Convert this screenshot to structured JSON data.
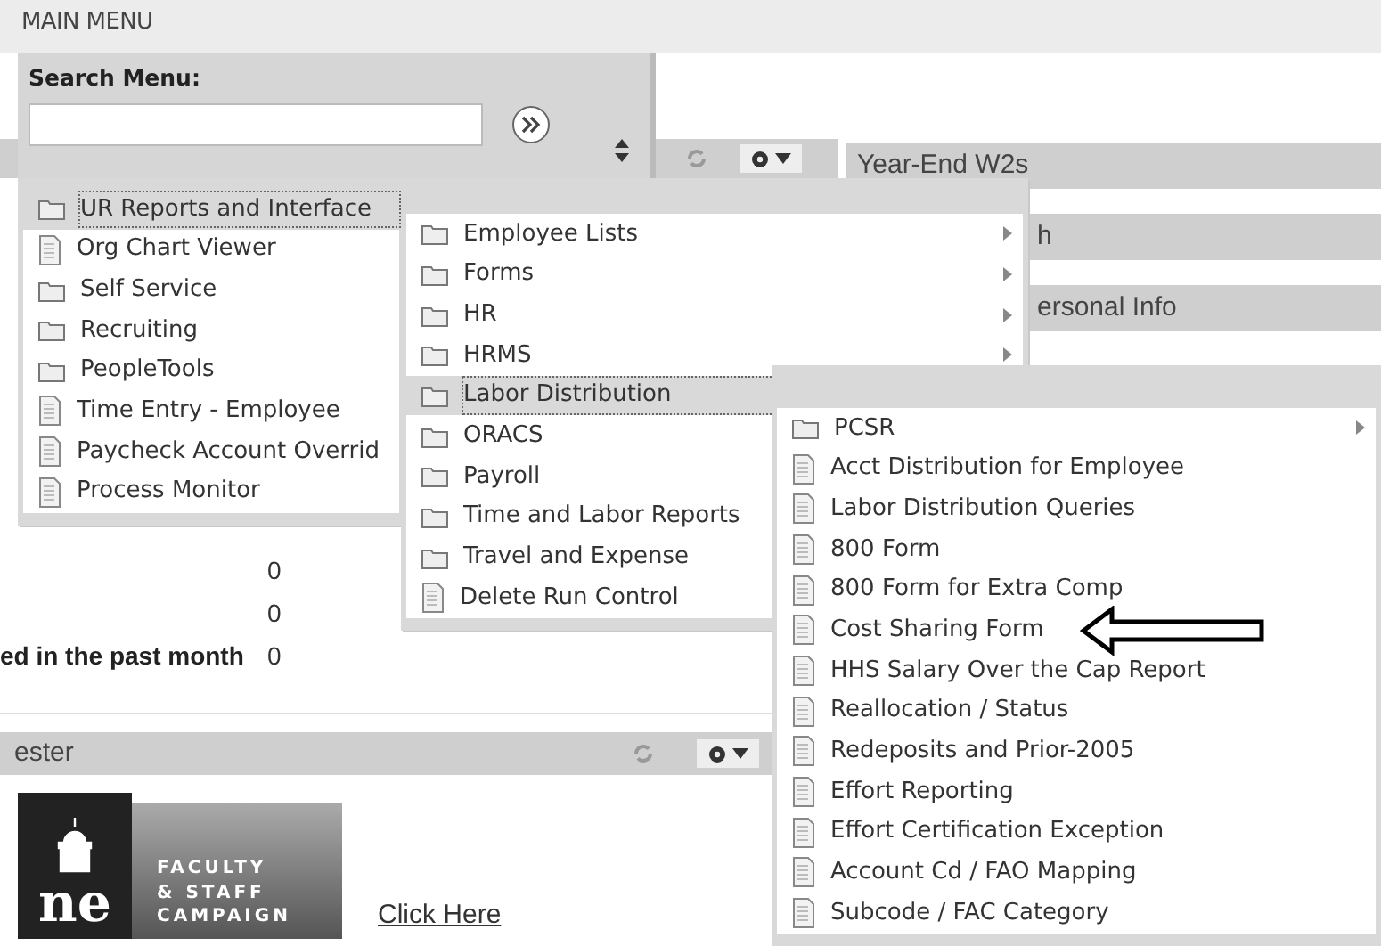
{
  "header": {
    "title": "MAIN MENU"
  },
  "search": {
    "label": "Search Menu:"
  },
  "left_pagelet": {
    "stats": [
      {
        "value": "0"
      },
      {
        "value": "0"
      },
      {
        "label": "ed in the past month",
        "value": "0"
      }
    ],
    "title": "ester",
    "banner": {
      "logo": "ne",
      "lines": [
        "FACULTY",
        "& STAFF",
        "CAMPAIGN"
      ]
    },
    "link": "Click Here"
  },
  "right_pagelets": [
    {
      "title": "Year-End W2s"
    },
    {
      "title": "h"
    },
    {
      "title": "ersonal Info"
    }
  ],
  "menu_levels": [
    {
      "items": [
        {
          "label": "UR Reports and Interface",
          "kind": "folder",
          "selected": true
        },
        {
          "label": "Org Chart Viewer",
          "kind": "page",
          "selected": false
        },
        {
          "label": "Self Service",
          "kind": "folder",
          "selected": false
        },
        {
          "label": "Recruiting",
          "kind": "folder",
          "selected": false
        },
        {
          "label": "PeopleTools",
          "kind": "folder",
          "selected": false
        },
        {
          "label": "Time Entry - Employee",
          "kind": "page",
          "selected": false
        },
        {
          "label": "Paycheck Account Overrid",
          "kind": "page",
          "selected": false
        },
        {
          "label": "Process Monitor",
          "kind": "page",
          "selected": false
        }
      ]
    },
    {
      "items": [
        {
          "label": "Employee Lists",
          "kind": "folder",
          "selected": false,
          "submenu": true
        },
        {
          "label": "Forms",
          "kind": "folder",
          "selected": false,
          "submenu": true
        },
        {
          "label": "HR",
          "kind": "folder",
          "selected": false,
          "submenu": true
        },
        {
          "label": "HRMS",
          "kind": "folder",
          "selected": false,
          "submenu": true
        },
        {
          "label": "Labor Distribution",
          "kind": "folder",
          "selected": true,
          "submenu": false
        },
        {
          "label": "ORACS",
          "kind": "folder",
          "selected": false,
          "submenu": false
        },
        {
          "label": "Payroll",
          "kind": "folder",
          "selected": false,
          "submenu": false
        },
        {
          "label": "Time and Labor Reports",
          "kind": "folder",
          "selected": false,
          "submenu": false
        },
        {
          "label": "Travel and Expense",
          "kind": "folder",
          "selected": false,
          "submenu": false
        },
        {
          "label": "Delete Run Control",
          "kind": "page",
          "selected": false,
          "submenu": false
        }
      ]
    },
    {
      "items": [
        {
          "label": "PCSR",
          "kind": "folder",
          "selected": false,
          "submenu": true
        },
        {
          "label": "Acct Distribution for Employee",
          "kind": "page",
          "selected": false,
          "submenu": false
        },
        {
          "label": "Labor Distribution Queries",
          "kind": "page",
          "selected": false,
          "submenu": false
        },
        {
          "label": "800 Form",
          "kind": "page",
          "selected": false,
          "submenu": false
        },
        {
          "label": "800 Form for Extra Comp",
          "kind": "page",
          "selected": false,
          "submenu": false
        },
        {
          "label": "Cost Sharing Form",
          "kind": "page",
          "selected": false,
          "submenu": false
        },
        {
          "label": "HHS Salary Over the Cap Report",
          "kind": "page",
          "selected": false,
          "submenu": false
        },
        {
          "label": "Reallocation / Status",
          "kind": "page",
          "selected": false,
          "submenu": false
        },
        {
          "label": "Redeposits and Prior-2005",
          "kind": "page",
          "selected": false,
          "submenu": false
        },
        {
          "label": "Effort Reporting",
          "kind": "page",
          "selected": false,
          "submenu": false
        },
        {
          "label": "Effort Certification Exception",
          "kind": "page",
          "selected": false,
          "submenu": false
        },
        {
          "label": "Account Cd / FAO Mapping",
          "kind": "page",
          "selected": false,
          "submenu": false
        },
        {
          "label": "Subcode / FAC Category",
          "kind": "page",
          "selected": false,
          "submenu": false
        }
      ]
    }
  ],
  "annotation": {
    "kind": "arrow"
  }
}
